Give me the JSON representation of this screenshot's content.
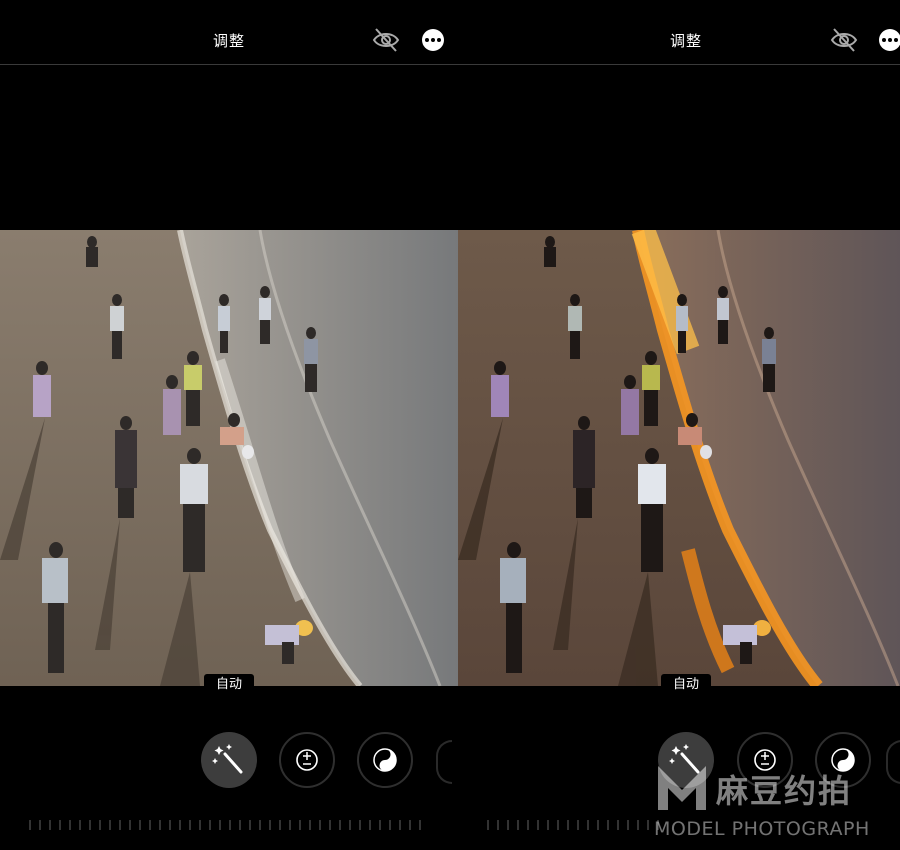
{
  "left_panel": {
    "header": {
      "title": "调整"
    },
    "auto_label": "自动",
    "tools": {
      "auto_icon": "magic-wand-icon",
      "exposure_icon": "exposure-plus-minus-icon",
      "contrast_icon": "yin-yang-icon"
    },
    "header_icons": {
      "hide": "eye-slash-icon",
      "more": "ellipsis-icon"
    }
  },
  "right_panel": {
    "header": {
      "title": "调整"
    },
    "auto_label": "自动",
    "tools": {
      "auto_icon": "magic-wand-icon",
      "exposure_icon": "exposure-plus-minus-icon",
      "contrast_icon": "yin-yang-icon"
    },
    "header_icons": {
      "hide": "eye-slash-icon",
      "more": "ellipsis-icon"
    }
  },
  "watermark": {
    "brand_cn": "麻豆约拍",
    "brand_en": "MODEL PHOTOGRAPH"
  },
  "colors": {
    "background": "#000000",
    "active_tool": "#3d3d3d",
    "warm_highlight": "#ff9a1f"
  }
}
